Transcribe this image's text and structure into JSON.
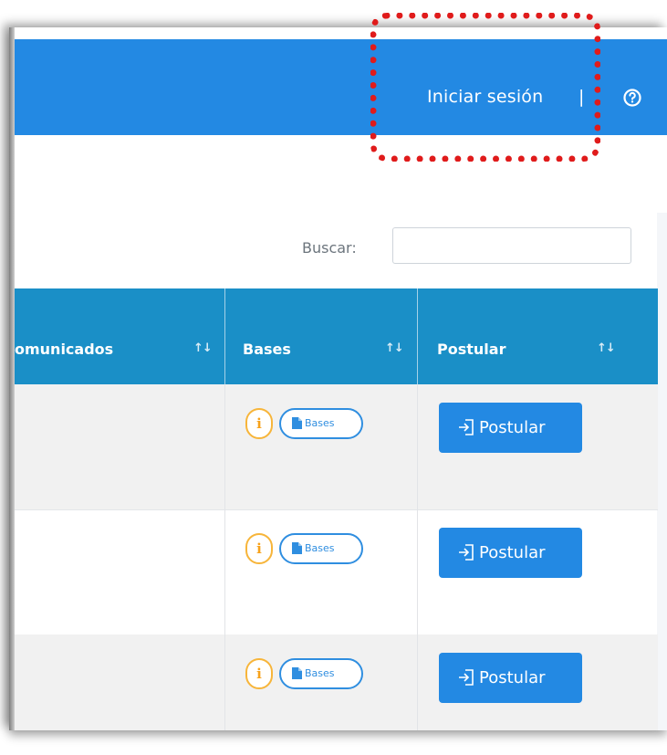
{
  "header": {
    "login_label": "Iniciar sesión",
    "separator": "|",
    "help_icon": "question-circle-icon"
  },
  "search": {
    "label": "Buscar:",
    "value": ""
  },
  "table": {
    "columns": [
      {
        "label": "omunicados",
        "sort_icon": "sort-icon"
      },
      {
        "label": "Bases",
        "sort_icon": "sort-icon"
      },
      {
        "label": "Postular",
        "sort_icon": "sort-icon"
      }
    ],
    "sort_glyph": "↑↓",
    "rows": [
      {
        "info_label": "i",
        "bases_label": "Bases",
        "postular_label": "Postular"
      },
      {
        "info_label": "i",
        "bases_label": "Bases",
        "postular_label": "Postular"
      },
      {
        "info_label": "i",
        "bases_label": "Bases",
        "postular_label": "Postular"
      }
    ]
  },
  "colors": {
    "header_bg": "#2389e3",
    "table_head_bg": "#1a8fc7",
    "info_accent": "#f7b53a",
    "bases_accent": "#2f8ee0",
    "highlight": "#e01b1b"
  }
}
